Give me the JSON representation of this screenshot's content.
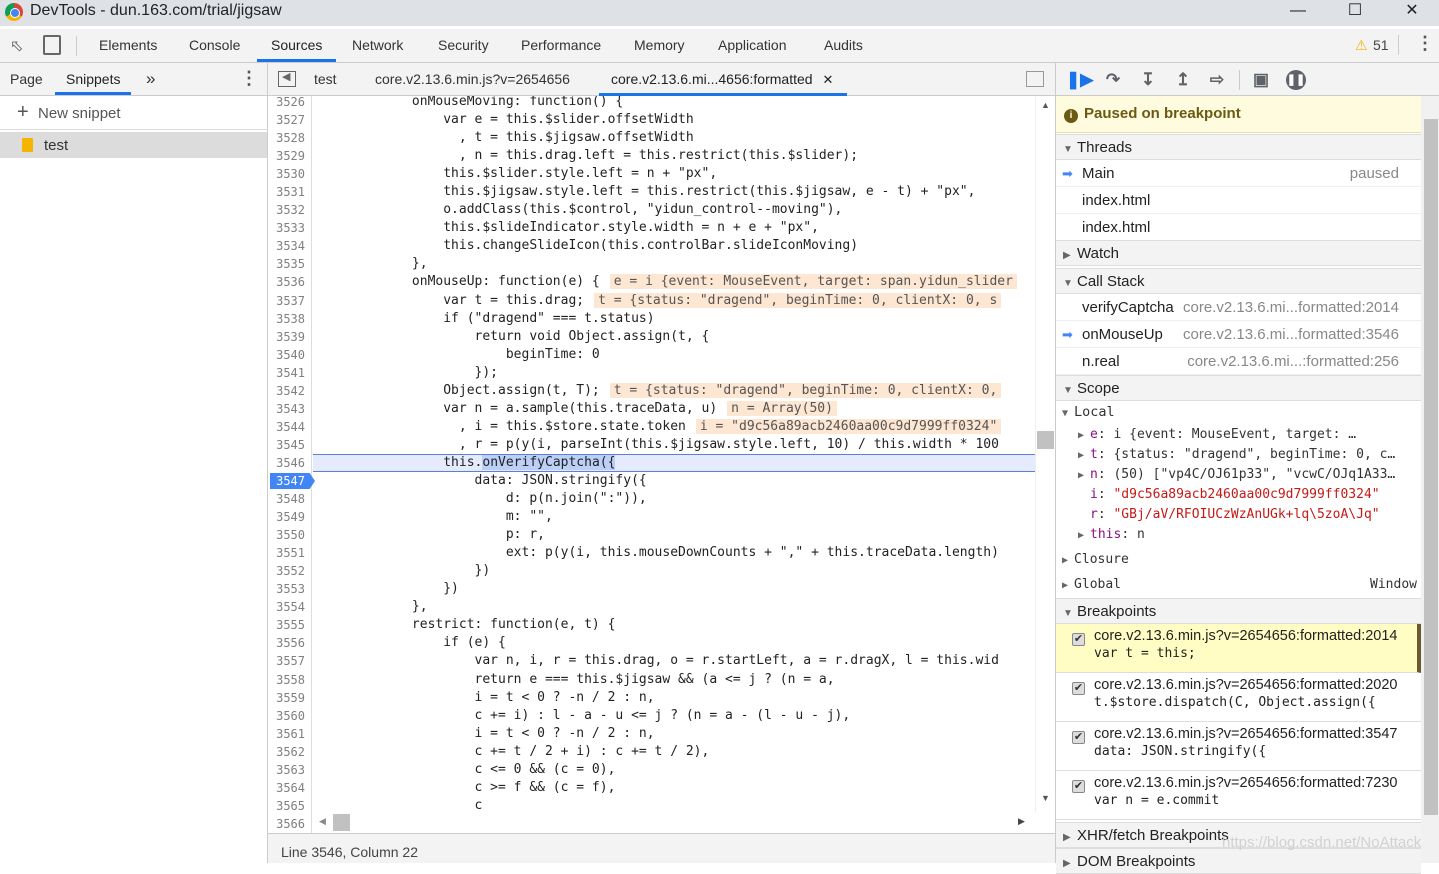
{
  "window": {
    "title": "DevTools - dun.163.com/trial/jigsaw"
  },
  "toolbar": {
    "tabs": [
      "Elements",
      "Console",
      "Sources",
      "Network",
      "Security",
      "Performance",
      "Memory",
      "Application",
      "Audits"
    ],
    "active": "Sources",
    "warnings": "51"
  },
  "navigator": {
    "tabs": [
      "Page",
      "Snippets"
    ],
    "active": "Snippets",
    "more": "»",
    "new_snippet": "New snippet",
    "snippets": [
      "test"
    ]
  },
  "editor_tabs": [
    {
      "label": "test"
    },
    {
      "label": "core.v2.13.6.min.js?v=2654656"
    },
    {
      "label": "core.v2.13.6.mi...4656:formatted",
      "active": true,
      "closable": true
    }
  ],
  "code": {
    "breakpoint_line": "3547",
    "current_line": "3546",
    "lines": [
      {
        "n": "3526",
        "t": "            onMouseMoving: function() {"
      },
      {
        "n": "3527",
        "t": "                var e = this.$slider.offsetWidth"
      },
      {
        "n": "3528",
        "t": "                  , t = this.$jigsaw.offsetWidth"
      },
      {
        "n": "3529",
        "t": "                  , n = this.drag.left = this.restrict(this.$slider);"
      },
      {
        "n": "3530",
        "t": "                this.$slider.style.left = n + \"px\","
      },
      {
        "n": "3531",
        "t": "                this.$jigsaw.style.left = this.restrict(this.$jigsaw, e - t) + \"px\","
      },
      {
        "n": "3532",
        "t": "                o.addClass(this.$control, \"yidun_control--moving\"),"
      },
      {
        "n": "3533",
        "t": "                this.$slideIndicator.style.width = n + e + \"px\","
      },
      {
        "n": "3534",
        "t": "                this.changeSlideIcon(this.controlBar.slideIconMoving)"
      },
      {
        "n": "3535",
        "t": "            },"
      },
      {
        "n": "3536",
        "t": "            onMouseUp: function(e) {",
        "v": "e = i {event: MouseEvent, target: span.yidun_slider"
      },
      {
        "n": "3537",
        "t": "                var t = this.drag;",
        "v": "t = {status: \"dragend\", beginTime: 0, clientX: 0, s"
      },
      {
        "n": "3538",
        "t": "                if (\"dragend\" === t.status)"
      },
      {
        "n": "3539",
        "t": "                    return void Object.assign(t, {"
      },
      {
        "n": "3540",
        "t": "                        beginTime: 0"
      },
      {
        "n": "3541",
        "t": "                    });"
      },
      {
        "n": "3542",
        "t": "                Object.assign(t, T);",
        "v": "t = {status: \"dragend\", beginTime: 0, clientX: 0,"
      },
      {
        "n": "3543",
        "t": "                var n = a.sample(this.traceData, u)",
        "v": "n = Array(50)"
      },
      {
        "n": "3544",
        "t": "                  , i = this.$store.state.token",
        "v": "i = \"d9c56a89acb2460aa00c9d7999ff0324\""
      },
      {
        "n": "3545",
        "t": "                  , r = p(y(i, parseInt(this.$jigsaw.style.left, 10) / this.width * 100"
      },
      {
        "n": "3546",
        "t": "                this.",
        "h": "onVerifyCaptcha({"
      },
      {
        "n": "3547",
        "t": "                    data: JSON.stringify({"
      },
      {
        "n": "3548",
        "t": "                        d: p(n.join(\":\")),"
      },
      {
        "n": "3549",
        "t": "                        m: \"\","
      },
      {
        "n": "3550",
        "t": "                        p: r,"
      },
      {
        "n": "3551",
        "t": "                        ext: p(y(i, this.mouseDownCounts + \",\" + this.traceData.length)"
      },
      {
        "n": "3552",
        "t": "                    })"
      },
      {
        "n": "3553",
        "t": "                })"
      },
      {
        "n": "3554",
        "t": "            },"
      },
      {
        "n": "3555",
        "t": "            restrict: function(e, t) {"
      },
      {
        "n": "3556",
        "t": "                if (e) {"
      },
      {
        "n": "3557",
        "t": "                    var n, i, r = this.drag, o = r.startLeft, a = r.dragX, l = this.wid"
      },
      {
        "n": "3558",
        "t": "                    return e === this.$jigsaw && (a <= j ? (n = a,"
      },
      {
        "n": "3559",
        "t": "                    i = t < 0 ? -n / 2 : n,"
      },
      {
        "n": "3560",
        "t": "                    c += i) : l - a - u <= j ? (n = a - (l - u - j),"
      },
      {
        "n": "3561",
        "t": "                    i = t < 0 ? -n / 2 : n,"
      },
      {
        "n": "3562",
        "t": "                    c += t / 2 + i) : c += t / 2),"
      },
      {
        "n": "3563",
        "t": "                    c <= 0 && (c = 0),"
      },
      {
        "n": "3564",
        "t": "                    c >= f && (c = f),"
      },
      {
        "n": "3565",
        "t": "                    c"
      },
      {
        "n": "3566",
        "t": ""
      }
    ]
  },
  "status": {
    "position": "Line 3546, Column 22"
  },
  "debugger": {
    "paused": "Paused on breakpoint",
    "threads": {
      "title": "Threads",
      "items": [
        {
          "name": "Main",
          "state": "paused"
        },
        {
          "name": "index.html"
        },
        {
          "name": "index.html"
        }
      ]
    },
    "watch": {
      "title": "Watch"
    },
    "call_stack": {
      "title": "Call Stack",
      "frames": [
        {
          "fn": "verifyCaptcha",
          "loc": "core.v2.13.6.mi...formatted:2014"
        },
        {
          "fn": "onMouseUp",
          "loc": "core.v2.13.6.mi...formatted:3546",
          "current": true
        },
        {
          "fn": "n.real",
          "loc": "core.v2.13.6.mi...:formatted:256"
        }
      ]
    },
    "scope": {
      "title": "Scope",
      "local": "Local",
      "vars": [
        {
          "k": "e",
          "v": "i {event: MouseEvent, target: …",
          "exp": true
        },
        {
          "k": "t",
          "v": "{status: \"dragend\", beginTime: 0, c…",
          "exp": true
        },
        {
          "k": "n",
          "v": "(50) [\"vp4C/OJ61p33\", \"vcwC/OJq1A33…",
          "exp": true
        },
        {
          "k": "i",
          "v": "\"d9c56a89acb2460aa00c9d7999ff0324\"",
          "str": true
        },
        {
          "k": "r",
          "v": "\"GBj/aV/RFOIUCzWzAnUGk+lq\\5zoA\\Jq\"",
          "str": true
        },
        {
          "k": "this",
          "v": "n",
          "exp": true
        }
      ],
      "closure": "Closure",
      "global": "Global",
      "global_value": "Window"
    },
    "breakpoints": {
      "title": "Breakpoints",
      "items": [
        {
          "loc": "core.v2.13.6.min.js?v=2654656:formatted:2014",
          "code": "var t = this;",
          "checked": true,
          "active": true
        },
        {
          "loc": "core.v2.13.6.min.js?v=2654656:formatted:2020",
          "code": "t.$store.dispatch(C, Object.assign({",
          "checked": true
        },
        {
          "loc": "core.v2.13.6.min.js?v=2654656:formatted:3547",
          "code": "data: JSON.stringify({",
          "checked": true
        },
        {
          "loc": "core.v2.13.6.min.js?v=2654656:formatted:7230",
          "code": "var n = e.commit",
          "checked": true
        }
      ]
    },
    "xhr": "XHR/fetch Breakpoints",
    "dom": "DOM Breakpoints"
  },
  "watermark": "https://blog.csdn.net/NoAttack",
  "colors": {
    "accent": "#1a73e8",
    "paused_bg": "#fffbdf",
    "inline_value_bg": "#fde6d2",
    "current_line_bg": "#e5ebfc"
  }
}
